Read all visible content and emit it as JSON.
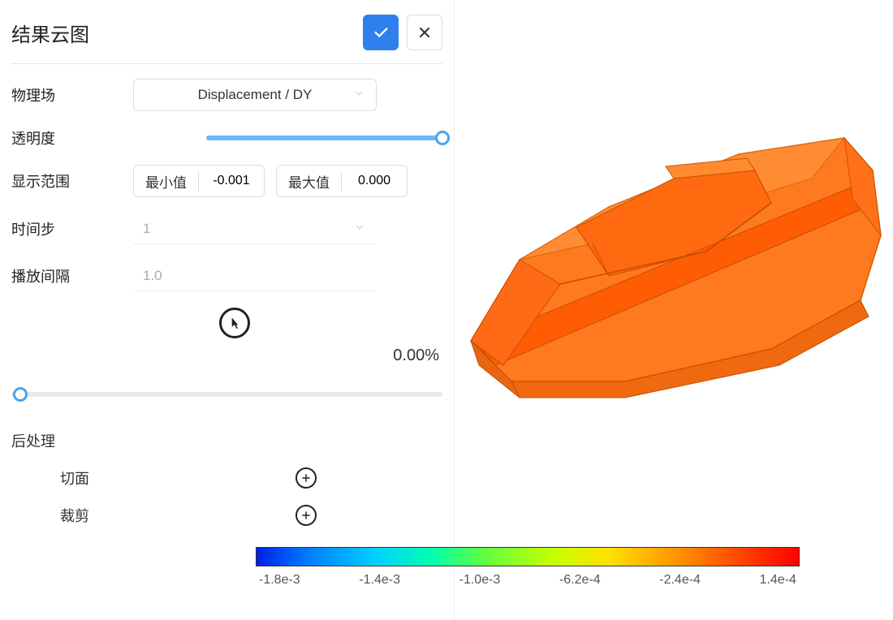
{
  "title": "结果云图",
  "labels": {
    "physicsField": "物理场",
    "opacity": "透明度",
    "displayRange": "显示范围",
    "minLabel": "最小值",
    "maxLabel": "最大值",
    "timeStep": "时间步",
    "playbackInterval": "播放间隔",
    "postProcessing": "后处理",
    "section": "切面",
    "clip": "裁剪"
  },
  "values": {
    "fieldSelected": "Displacement / DY",
    "opacityPercent": 100,
    "minValue": "-0.001",
    "maxValue": "0.000",
    "timeStep": "1",
    "playbackInterval": "1.0",
    "progressText": "0.00%",
    "progressPercent": 0
  },
  "colorbar": {
    "ticks": [
      "-1.8e-3",
      "-1.4e-3",
      "-1.0e-3",
      "-6.2e-4",
      "-2.4e-4",
      "1.4e-4"
    ]
  }
}
